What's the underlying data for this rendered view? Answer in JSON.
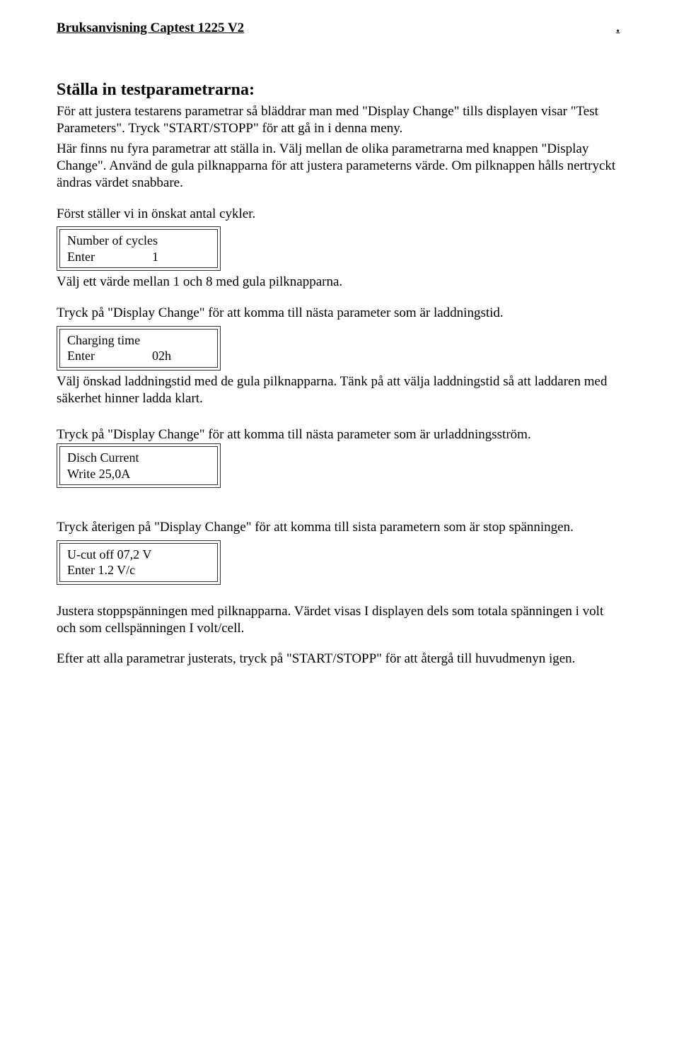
{
  "header": {
    "title": "Bruksanvisning  Captest 1225 V2",
    "dot": "."
  },
  "h1": "Ställa in testparametrarna:",
  "intro1": "För att justera testarens parametrar så bläddrar man med \"Display Change\" tills displayen visar \"Test Parameters\". Tryck \"START/STOPP\" för att gå in i denna meny.",
  "intro2": "Här finns nu fyra parametrar att ställa in. Välj mellan de olika parametrarna med knappen \"Display Change\". Använd de gula pilknapparna för att justera parameterns värde. Om pilknappen hålls nertryckt ändras värdet snabbare.",
  "intro3": "Först ställer vi in önskat antal cykler.",
  "box1": {
    "line1": "Number of cycles",
    "line2left": "Enter",
    "line2right": "1"
  },
  "aftBox1a": "Välj ett värde mellan 1 och 8 med gula pilknapparna.",
  "aftBox1b": "Tryck på \"Display Change\" för att komma till nästa parameter som är laddningstid.",
  "box2": {
    "line1": "Charging time",
    "line2left": "Enter",
    "line2right": "02h"
  },
  "aftBox2": "Välj önskad laddningstid med de gula pilknapparna. Tänk på att välja laddningstid så att laddaren med säkerhet hinner ladda klart.",
  "aftBox2b": "Tryck på \"Display Change\" för att komma till nästa parameter som är urladdningsström.",
  "box3": {
    "line1": "Disch Current",
    "line2": " Write 25,0A"
  },
  "aftBox3": "Tryck återigen på \"Display Change\" för att komma till sista parametern som är stop spänningen.",
  "box4": {
    "line1": "U-cut off  07,2 V",
    "line2": "Enter    1.2 V/c"
  },
  "aftBox4a": "Justera stoppspänningen med pilknapparna. Värdet visas I displayen dels som totala spänningen i volt och som cellspänningen I volt/cell.",
  "aftBox4b": "Efter att alla parametrar justerats, tryck på \"START/STOPP\" för att återgå till huvudmenyn igen."
}
